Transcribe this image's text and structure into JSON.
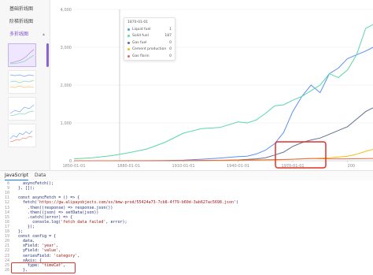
{
  "sidebar": {
    "items": [
      {
        "label": "基础折线图",
        "active": false
      },
      {
        "label": "阶梯折线图",
        "active": false
      },
      {
        "label": "多折线图",
        "active": true
      }
    ]
  },
  "chart_data": {
    "type": "line",
    "x_ticks": [
      "1850-01-01",
      "1880-01-01",
      "1910-01-01",
      "1940-01-01",
      "1970-01-01",
      "200"
    ],
    "y_ticks": [
      "0",
      "1,000",
      "2,000",
      "3,000",
      "4,000"
    ],
    "ylim": [
      0,
      4000
    ],
    "xlim": [
      1850,
      2014
    ],
    "grid": true,
    "series": [
      {
        "name": "Liquid fuel",
        "color": "#5b8ff9",
        "x": [
          1850,
          1870,
          1890,
          1900,
          1910,
          1920,
          1930,
          1940,
          1945,
          1950,
          1955,
          1960,
          1965,
          1970,
          1975,
          1980,
          1985,
          1990,
          1995,
          2000,
          2005,
          2010,
          2014
        ],
        "values": [
          0,
          0,
          2,
          5,
          15,
          40,
          70,
          110,
          120,
          180,
          280,
          450,
          750,
          1300,
          1700,
          2000,
          1800,
          2300,
          2450,
          2700,
          2800,
          2900,
          3000
        ]
      },
      {
        "name": "Solid fuel",
        "color": "#5ad8a6",
        "x": [
          1850,
          1860,
          1870,
          1880,
          1890,
          1900,
          1910,
          1920,
          1930,
          1940,
          1945,
          1950,
          1955,
          1960,
          1965,
          1970,
          1975,
          1980,
          1985,
          1990,
          1995,
          2000,
          2005,
          2010,
          2014
        ],
        "values": [
          50,
          80,
          130,
          210,
          310,
          490,
          730,
          850,
          880,
          1030,
          1000,
          1080,
          1250,
          1450,
          1480,
          1600,
          1700,
          1850,
          2000,
          2300,
          2200,
          2400,
          2800,
          3500,
          3600
        ]
      },
      {
        "name": "Gas fuel",
        "color": "#5d7092",
        "x": [
          1850,
          1890,
          1910,
          1930,
          1940,
          1950,
          1955,
          1960,
          1965,
          1970,
          1975,
          1980,
          1985,
          1990,
          1995,
          2000,
          2005,
          2010,
          2014
        ],
        "values": [
          0,
          0,
          2,
          10,
          20,
          50,
          80,
          150,
          230,
          380,
          480,
          550,
          600,
          700,
          800,
          900,
          1100,
          1300,
          1400
        ]
      },
      {
        "name": "Cement production",
        "color": "#f6bd16",
        "x": [
          1850,
          1920,
          1940,
          1960,
          1970,
          1980,
          1990,
          2000,
          2005,
          2010,
          2014
        ],
        "values": [
          0,
          2,
          5,
          20,
          40,
          60,
          80,
          120,
          170,
          250,
          300
        ]
      },
      {
        "name": "Gas flarin",
        "color": "#e8684a",
        "x": [
          1850,
          1900,
          1950,
          1970,
          1980,
          1990,
          2000,
          2014
        ],
        "values": [
          0,
          0,
          20,
          40,
          60,
          50,
          50,
          60
        ]
      }
    ]
  },
  "tooltip": {
    "title": "1870-01-01",
    "rows": [
      {
        "name": "Liquid fuel",
        "value": "1",
        "color": "#5b8ff9"
      },
      {
        "name": "Solid fuel",
        "value": "187",
        "color": "#5ad8a6"
      },
      {
        "name": "Gas fuel",
        "value": "0",
        "color": "#5d7092"
      },
      {
        "name": "Cement production",
        "value": "0",
        "color": "#f6bd16"
      },
      {
        "name": "Gas flarin",
        "value": "0",
        "color": "#e8684a"
      }
    ]
  },
  "tabs": [
    {
      "label": "JavaScript",
      "active": true
    },
    {
      "label": "Data",
      "active": false
    }
  ],
  "code": {
    "lines": [
      {
        "n": "8",
        "text": "    asyncFetch();"
      },
      {
        "n": "9",
        "text": "  }, []);"
      },
      {
        "n": "10",
        "text": ""
      },
      {
        "n": "11",
        "text": "  const asyncFetch = () => {"
      },
      {
        "n": "12",
        "text": "    fetch('https://gw.alipayobjects.com/os/bmw-prod/55424a73-7cb8-4f79-b60d-3ab627ac5698.json')"
      },
      {
        "n": "13",
        "text": "      .then((response) => response.json())"
      },
      {
        "n": "14",
        "text": "      .then((json) => setData(json))"
      },
      {
        "n": "15",
        "text": "      .catch((error) => {"
      },
      {
        "n": "16",
        "text": "        console.log('fetch data failed', error);"
      },
      {
        "n": "17",
        "text": "      });"
      },
      {
        "n": "18",
        "text": "  };"
      },
      {
        "n": "19",
        "text": "  const config = {"
      },
      {
        "n": "20",
        "text": "    data,"
      },
      {
        "n": "21",
        "text": "    xField: 'year',"
      },
      {
        "n": "22",
        "text": "    yField: 'value',"
      },
      {
        "n": "23",
        "text": "    seriesField: 'category',"
      },
      {
        "n": "24",
        "text": "    xAxis: {"
      },
      {
        "n": "25",
        "text": "      type: 'timeCat',"
      },
      {
        "n": "26",
        "text": "    },"
      }
    ]
  }
}
